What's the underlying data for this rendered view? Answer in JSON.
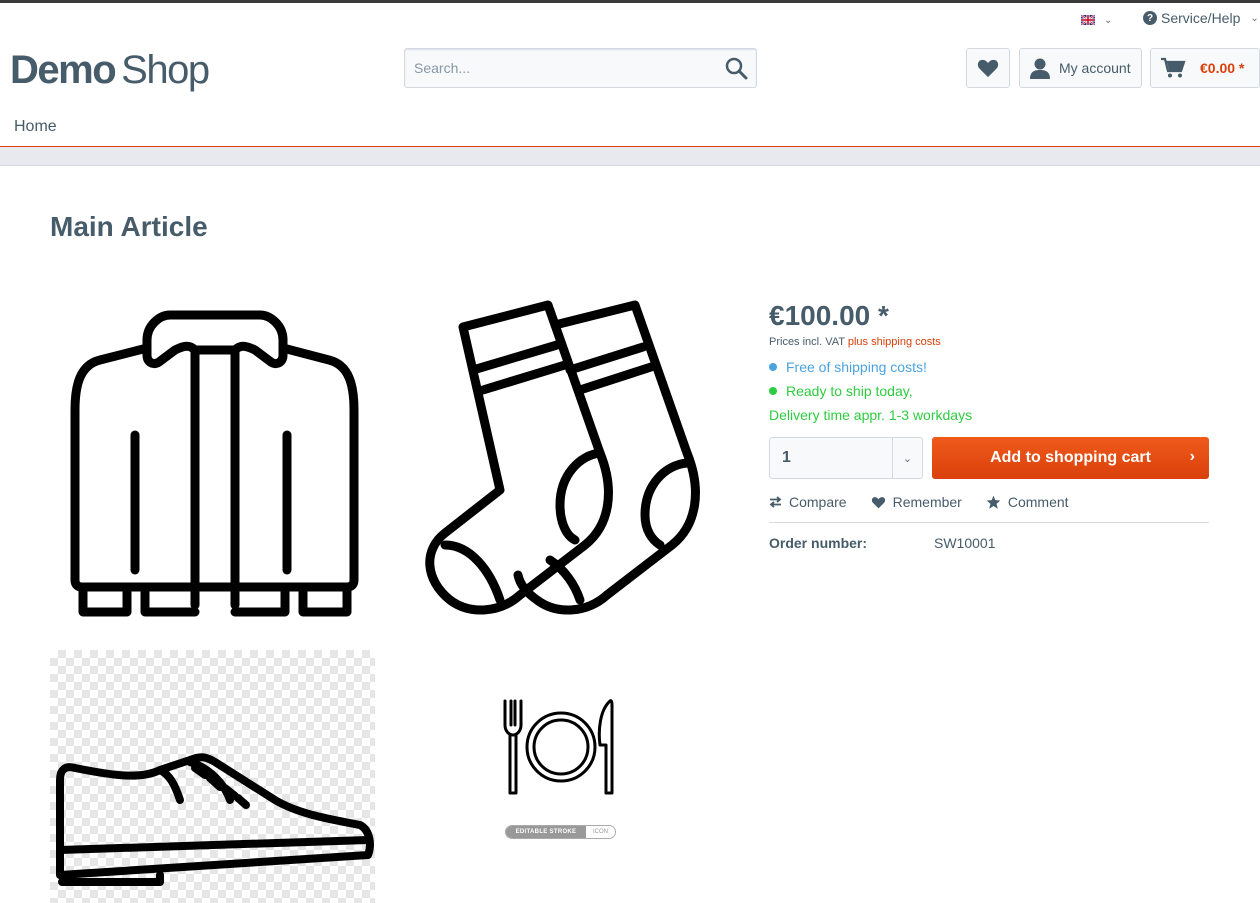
{
  "header": {
    "language_flag": "uk-flag-icon",
    "service_help": "Service/Help",
    "logo_bold": "Demo",
    "logo_light": "Shop",
    "search_placeholder": "Search...",
    "my_account": "My account",
    "cart_amount": "€0.00 *"
  },
  "nav": {
    "home": "Home"
  },
  "product": {
    "title": "Main Article",
    "price": "€100.00 *",
    "vat_prefix": "Prices incl. VAT",
    "vat_shipping": "plus shipping costs",
    "free_shipping": "Free of shipping costs!",
    "ready_to_ship": "Ready to ship today,",
    "delivery_time": "Delivery time appr. 1-3 workdays",
    "quantity": "1",
    "add_to_cart": "Add to shopping cart",
    "add_to_cart_arrow": "›",
    "actions": {
      "compare": "Compare",
      "remember": "Remember",
      "comment": "Comment"
    },
    "order_number_label": "Order number:",
    "order_number": "SW10001",
    "images": [
      "jacket-icon",
      "socks-icon",
      "shoe-icon",
      "plate-cutlery-icon"
    ],
    "badge_left": "EDITABLE STROKE",
    "badge_right": "ICON"
  },
  "colors": {
    "accent": "#d9400b",
    "text": "#475c6a",
    "info": "#4aa3df",
    "success": "#2ecc40"
  }
}
